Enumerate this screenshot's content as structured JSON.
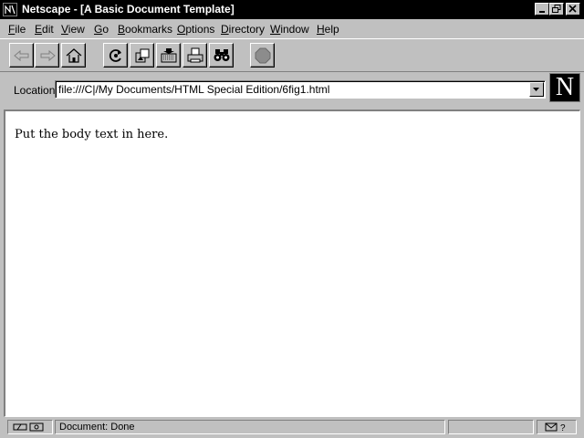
{
  "window": {
    "title": "Netscape - [A Basic Document Template]"
  },
  "menubar": {
    "items": [
      {
        "label": "File",
        "key": "F",
        "rest": "ile"
      },
      {
        "label": "Edit",
        "key": "E",
        "rest": "dit"
      },
      {
        "label": "View",
        "key": "V",
        "rest": "iew"
      },
      {
        "label": "Go",
        "key": "G",
        "rest": "o"
      },
      {
        "label": "Bookmarks",
        "key": "B",
        "rest": "ookmarks"
      },
      {
        "label": "Options",
        "key": "O",
        "rest": "ptions"
      },
      {
        "label": "Directory",
        "key": "D",
        "rest": "irectory"
      },
      {
        "label": "Window",
        "key": "W",
        "rest": "indow"
      },
      {
        "label": "Help",
        "key": "H",
        "rest": "elp"
      }
    ]
  },
  "toolbar": {
    "buttons": [
      "back-icon",
      "forward-icon",
      "home-icon",
      "reload-icon",
      "images-icon",
      "open-icon",
      "print-icon",
      "find-icon",
      "stop-icon"
    ]
  },
  "location": {
    "label": "Location:",
    "value": "file:///C|/My Documents/HTML Special Edition/6fig1.html"
  },
  "logo": {
    "letter": "N"
  },
  "content": {
    "body_text": "Put the body text in here."
  },
  "status": {
    "text": "Document: Done"
  },
  "colors": {
    "chrome": "#c0c0c0",
    "titlebar": "#000000",
    "content": "#ffffff"
  }
}
